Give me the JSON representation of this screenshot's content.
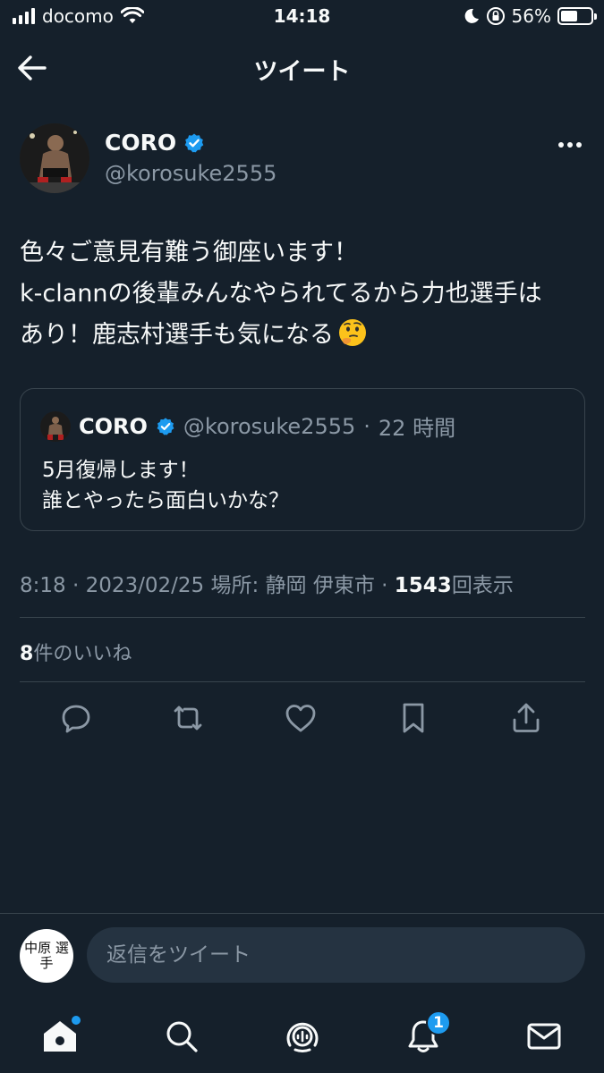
{
  "status_bar": {
    "carrier": "docomo",
    "time": "14:18",
    "battery_percent": "56%",
    "battery_level": 0.56,
    "icons": [
      "signal-icon",
      "wifi-icon",
      "moon-icon",
      "orientation-lock-icon",
      "battery-icon"
    ]
  },
  "header": {
    "title": "ツイート",
    "back_icon": "arrow-left-icon"
  },
  "tweet": {
    "author_name": "CORO",
    "author_handle": "@korosuke2555",
    "verified": true,
    "lines": [
      "色々ご意見有難う御座います！",
      "k-clannの後輩みんなやられてるから力也選手は",
      "あり！鹿志村選手も気になる"
    ],
    "emoji": "thinking-face",
    "quote": {
      "author_name": "CORO",
      "author_handle": "@korosuke2555",
      "separator": "·",
      "time_ago": "22 時間",
      "lines": [
        "5月復帰します！",
        "誰とやったら面白いかな？"
      ]
    },
    "meta": {
      "time": "8:18",
      "sep1": "·",
      "date": "2023/02/25",
      "location_label": "場所:",
      "location": "静岡 伊東市",
      "sep2": "·",
      "views": "1543",
      "views_label": "回表示"
    },
    "likes": {
      "count": "8",
      "label": "件のいいね"
    },
    "actions": [
      "reply-icon",
      "retweet-icon",
      "like-icon",
      "bookmark-icon",
      "share-icon"
    ]
  },
  "reply_bar": {
    "user_avatar_text": "中原 選手",
    "placeholder": "返信をツイート"
  },
  "tab_bar": {
    "tabs": [
      "home-icon",
      "search-icon",
      "spaces-icon",
      "notifications-icon",
      "messages-icon"
    ],
    "notification_count": "1"
  },
  "colors": {
    "background": "#15202b",
    "text": "#f7f9f9",
    "secondary_text": "#8b98a5",
    "accent": "#1d9bf0",
    "border": "#38444d"
  }
}
